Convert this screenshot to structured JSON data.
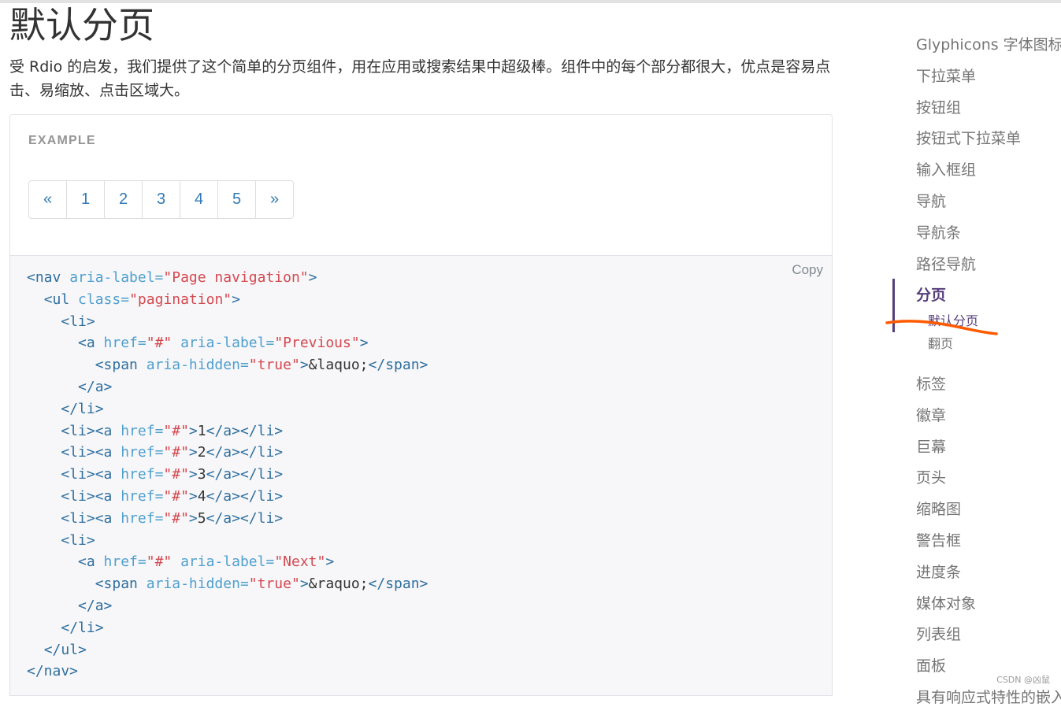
{
  "heading": "默认分页",
  "lead": "受 Rdio 的启发，我们提供了这个简单的分页组件，用在应用或搜索结果中超级棒。组件中的每个部分都很大，优点是容易点击、易缩放、点击区域大。",
  "example": {
    "label": "EXAMPLE",
    "pagination": [
      "«",
      "1",
      "2",
      "3",
      "4",
      "5",
      "»"
    ]
  },
  "code": {
    "copy_label": "Copy",
    "lines": [
      [
        [
          "t",
          "<nav "
        ],
        [
          "a",
          "aria-label="
        ],
        [
          "s",
          "\"Page navigation\""
        ],
        [
          "t",
          ">"
        ]
      ],
      [
        [
          "p",
          "  "
        ],
        [
          "t",
          "<ul "
        ],
        [
          "a",
          "class="
        ],
        [
          "s",
          "\"pagination\""
        ],
        [
          "t",
          ">"
        ]
      ],
      [
        [
          "p",
          "    "
        ],
        [
          "t",
          "<li>"
        ]
      ],
      [
        [
          "p",
          "      "
        ],
        [
          "t",
          "<a "
        ],
        [
          "a",
          "href="
        ],
        [
          "s",
          "\"#\""
        ],
        [
          "p",
          " "
        ],
        [
          "a",
          "aria-label="
        ],
        [
          "s",
          "\"Previous\""
        ],
        [
          "t",
          ">"
        ]
      ],
      [
        [
          "p",
          "        "
        ],
        [
          "t",
          "<span "
        ],
        [
          "a",
          "aria-hidden="
        ],
        [
          "s",
          "\"true\""
        ],
        [
          "t",
          ">"
        ],
        [
          "e",
          "&laquo;"
        ],
        [
          "t",
          "</span>"
        ]
      ],
      [
        [
          "p",
          "      "
        ],
        [
          "t",
          "</a>"
        ]
      ],
      [
        [
          "p",
          "    "
        ],
        [
          "t",
          "</li>"
        ]
      ],
      [
        [
          "p",
          "    "
        ],
        [
          "t",
          "<li><a "
        ],
        [
          "a",
          "href="
        ],
        [
          "s",
          "\"#\""
        ],
        [
          "t",
          ">"
        ],
        [
          "e",
          "1"
        ],
        [
          "t",
          "</a></li>"
        ]
      ],
      [
        [
          "p",
          "    "
        ],
        [
          "t",
          "<li><a "
        ],
        [
          "a",
          "href="
        ],
        [
          "s",
          "\"#\""
        ],
        [
          "t",
          ">"
        ],
        [
          "e",
          "2"
        ],
        [
          "t",
          "</a></li>"
        ]
      ],
      [
        [
          "p",
          "    "
        ],
        [
          "t",
          "<li><a "
        ],
        [
          "a",
          "href="
        ],
        [
          "s",
          "\"#\""
        ],
        [
          "t",
          ">"
        ],
        [
          "e",
          "3"
        ],
        [
          "t",
          "</a></li>"
        ]
      ],
      [
        [
          "p",
          "    "
        ],
        [
          "t",
          "<li><a "
        ],
        [
          "a",
          "href="
        ],
        [
          "s",
          "\"#\""
        ],
        [
          "t",
          ">"
        ],
        [
          "e",
          "4"
        ],
        [
          "t",
          "</a></li>"
        ]
      ],
      [
        [
          "p",
          "    "
        ],
        [
          "t",
          "<li><a "
        ],
        [
          "a",
          "href="
        ],
        [
          "s",
          "\"#\""
        ],
        [
          "t",
          ">"
        ],
        [
          "e",
          "5"
        ],
        [
          "t",
          "</a></li>"
        ]
      ],
      [
        [
          "p",
          "    "
        ],
        [
          "t",
          "<li>"
        ]
      ],
      [
        [
          "p",
          "      "
        ],
        [
          "t",
          "<a "
        ],
        [
          "a",
          "href="
        ],
        [
          "s",
          "\"#\""
        ],
        [
          "p",
          " "
        ],
        [
          "a",
          "aria-label="
        ],
        [
          "s",
          "\"Next\""
        ],
        [
          "t",
          ">"
        ]
      ],
      [
        [
          "p",
          "        "
        ],
        [
          "t",
          "<span "
        ],
        [
          "a",
          "aria-hidden="
        ],
        [
          "s",
          "\"true\""
        ],
        [
          "t",
          ">"
        ],
        [
          "e",
          "&raquo;"
        ],
        [
          "t",
          "</span>"
        ]
      ],
      [
        [
          "p",
          "      "
        ],
        [
          "t",
          "</a>"
        ]
      ],
      [
        [
          "p",
          "    "
        ],
        [
          "t",
          "</li>"
        ]
      ],
      [
        [
          "p",
          "  "
        ],
        [
          "t",
          "</ul>"
        ]
      ],
      [
        [
          "t",
          "</nav>"
        ]
      ]
    ]
  },
  "sidebar": {
    "items": [
      "Glyphicons 字体图标",
      "下拉菜单",
      "按钮组",
      "按钮式下拉菜单",
      "输入框组",
      "导航",
      "导航条",
      "路径导航",
      "分页"
    ],
    "active_index": 8,
    "subitems": [
      "默认分页",
      "翻页"
    ],
    "active_sub_index": 0,
    "items_after": [
      "标签",
      "徽章",
      "巨幕",
      "页头",
      "缩略图",
      "警告框",
      "进度条",
      "媒体对象",
      "列表组",
      "面板",
      "具有响应式特性的嵌入内容"
    ]
  },
  "watermark": "CSDN @凶鼠",
  "colors": {
    "link": "#337ab7",
    "active": "#563d7c",
    "annotation": "#ff5a00",
    "code_tag": "#2f6f9f",
    "code_attr": "#4f9fcf",
    "code_string": "#d44950"
  }
}
